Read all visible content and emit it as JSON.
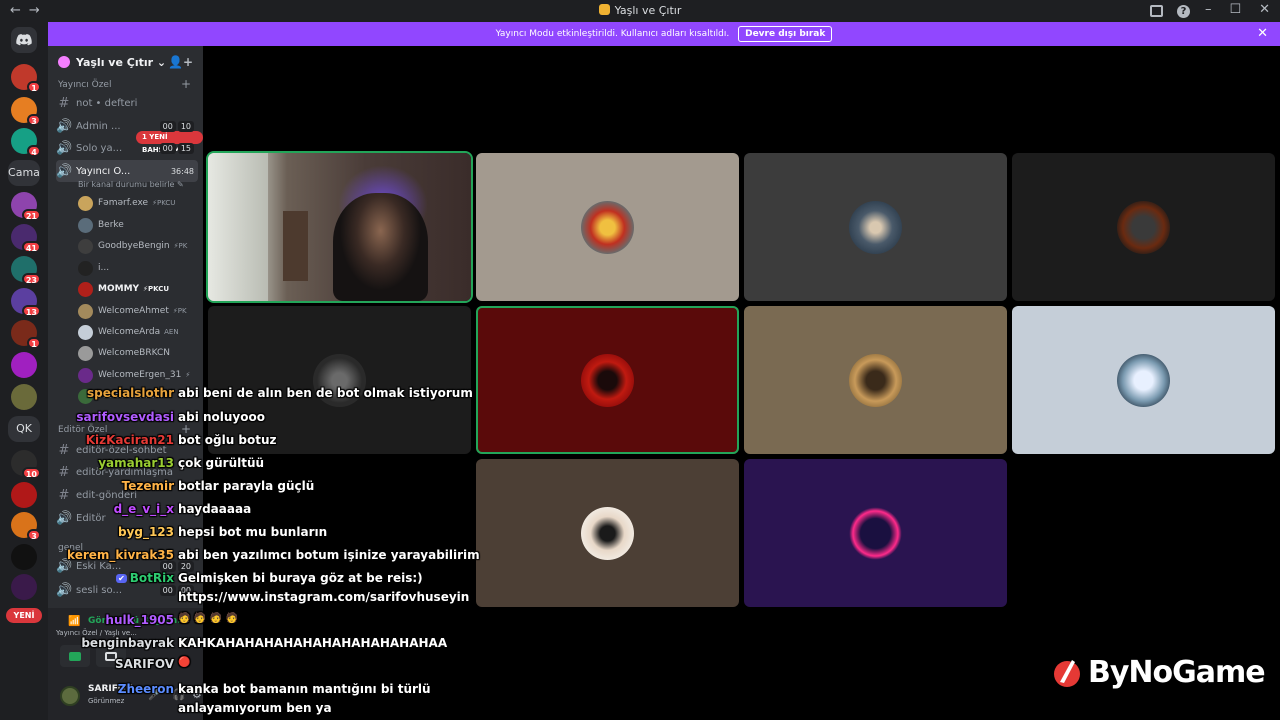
{
  "window": {
    "title": "Yaşlı ve Çıtır",
    "nav_icons": [
      "back-arrow-icon",
      "forward-arrow-icon"
    ],
    "controls": [
      "minimize",
      "maximize",
      "close"
    ]
  },
  "banner": {
    "text": "Yayıncı Modu etkinleştirildi. Kullanıcı adları kısaltıldı.",
    "button_label": "Devre dışı bırak",
    "color": "#9147ff"
  },
  "guilds": {
    "home_icon": "discord-icon",
    "text_guild": "Cama",
    "text_guild_2": "QK",
    "badges": [
      "1",
      "3",
      "4",
      "21",
      "41",
      "23",
      "13",
      "1",
      "10",
      "3"
    ],
    "new_pill": "YENİ"
  },
  "server": {
    "name": "Yaşlı ve Çıtır",
    "categories": {
      "c1": "Yayıncı Özel",
      "c2": "Editör Özel",
      "c3": "genel"
    },
    "mention_pill": "1 YENİ BAHSETME",
    "channels": {
      "notes": "not • defteri",
      "admin": "Admin ...",
      "solo": "Solo ya...",
      "yayinci": "Yayıncı Ö...",
      "editor_chat": "editör-özel-sohbet",
      "editor_help": "editör-yardımlaşma",
      "edit_send": "edit-gönderi",
      "editor_voice": "Editör",
      "eski": "Eski Ka...",
      "sesli": "sesli so..."
    },
    "channel_tags": {
      "admin": [
        "00",
        "10"
      ],
      "solo": [
        "00",
        "15"
      ],
      "yayinci_timer": "36:48",
      "eski": [
        "00",
        "20"
      ],
      "sesli": [
        "00",
        "00"
      ]
    },
    "channel_status": "Bir kanal durumu belirle ✎",
    "members": [
      "Fəmərf.exe",
      "Berke",
      "GoodbyeBengin",
      "i...",
      "MOMMY",
      "WelcomeAhmet",
      "WelcomeArda",
      "WelcomeBRKCN",
      "WelcomeErgen_31",
      "WelcomeKra..."
    ],
    "member_subs": [
      "⚡PKCU",
      "",
      "⚡PK",
      "",
      "⚡PKCU",
      "⚡PK",
      "AEN",
      "",
      "⚡",
      ""
    ]
  },
  "voice_panel": {
    "title": "Görüntülü Bağlan...",
    "subtitle": "Yayıncı Özel / Yaşlı ve...",
    "icons": [
      "signal-icon",
      "camera-icon",
      "screen-share-icon"
    ]
  },
  "user_panel": {
    "name": "SARIFOV",
    "status": "Görünmez"
  },
  "chat": [
    {
      "user": "specialslothr",
      "color": "#e6a23c",
      "msg": "abi beni de alın ben de bot olmak istiyorum"
    },
    {
      "user": "sarifovsevdasi",
      "color": "#b05cff",
      "msg": "abi noluyooo"
    },
    {
      "user": "KizKaciran21",
      "color": "#e53935",
      "msg": "bot oğlu botuz"
    },
    {
      "user": "yamahar13",
      "color": "#9acd32",
      "msg": "çok gürültüü"
    },
    {
      "user": "Tezemir",
      "color": "#ffb347",
      "msg": "botlar parayla güçlü"
    },
    {
      "user": "d_e_v_i_x",
      "color": "#c04cff",
      "msg": "haydaaaaa"
    },
    {
      "user": "byg_123",
      "color": "#ffc857",
      "msg": "hepsi bot mu bunların"
    },
    {
      "user": "kerem_kivrak35",
      "color": "#ffb347",
      "msg": "abi ben yazılımcı botum işinize yarayabilirim"
    },
    {
      "user": "BotRix",
      "color": "#2ecc71",
      "msg": "Gelmişken bi buraya göz at be reis:)"
    },
    {
      "user": "",
      "color": "#ffffff",
      "msg": "https://www.instagram.com/sarifovhuseyin"
    },
    {
      "user": "hulk_1905",
      "color": "#b05cff",
      "msg": "🧑 🧑 🧑 🧑"
    },
    {
      "user": "benginbayrak",
      "color": "#dbdee1",
      "msg": "KAHKAHAHAHAHAHAHAHAHAHAHAHAA"
    },
    {
      "user": "SARIFOV",
      "color": "#dbdee1",
      "msg": "🔴"
    },
    {
      "user": "Zheeron",
      "color": "#5b8cff",
      "msg": "kanka bot bamanın mantığını bi türlü"
    },
    {
      "user": "",
      "color": "#ffffff",
      "msg": "anlayamıyorum ben ya"
    }
  ],
  "logo": {
    "text": "ByNoGame"
  },
  "colors": {
    "speaking": "#23a559",
    "tile_beige": "#a39a8f",
    "tile_gray": "#3c3c3c",
    "tile_dark": "#1c1c1c",
    "tile_red": "#5a0a0a",
    "tile_khaki": "#7a6a52",
    "tile_light": "#c5ced8",
    "tile_brown": "#4c3f35",
    "tile_purple": "#2a1450"
  }
}
